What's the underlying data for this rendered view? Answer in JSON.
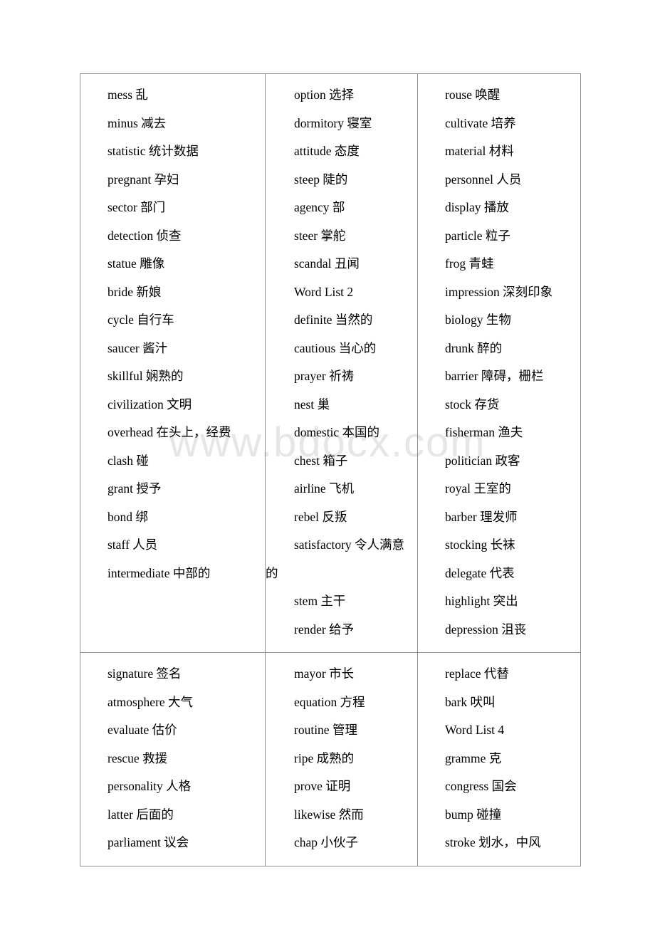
{
  "document": {
    "type": "vocabulary-table",
    "watermark": "www.bdocx.com",
    "page_background": "#ffffff",
    "border_color": "#8f8f8f",
    "text_color": "#000000",
    "watermark_color": "#e6e6e6"
  },
  "table": {
    "rows": [
      {
        "cells": [
          {
            "column": 1,
            "entries": [
              "mess 乱",
              "minus 减去",
              "statistic 统计数据",
              "pregnant 孕妇",
              "sector 部门",
              "detection 侦查",
              "statue 雕像",
              "bride 新娘",
              "cycle 自行车",
              "saucer 酱汁",
              "skillful 娴熟的",
              "civilization 文明",
              "overhead 在头上，经费",
              "clash 碰",
              "grant 授予",
              "bond 绑",
              "staff 人员",
              "intermediate 中部的"
            ]
          },
          {
            "column": 2,
            "entries": [
              "option 选择",
              "dormitory 寝室",
              "attitude 态度",
              "steep 陡的",
              "agency 部",
              "steer 掌舵",
              "scandal 丑闻",
              "Word List 2",
              "definite 当然的",
              "cautious 当心的",
              "prayer 祈祷",
              "nest 巢",
              "domestic 本国的",
              "chest 箱子",
              "airline 飞机",
              "rebel 反叛",
              "satisfactory 令人满意的",
              "stem 主干",
              "render 给予"
            ]
          },
          {
            "column": 3,
            "entries": [
              "rouse 唤醒",
              "cultivate 培养",
              "material 材料",
              "personnel 人员",
              "display 播放",
              "particle 粒子",
              "frog 青蛙",
              "impression 深刻印象",
              "biology 生物",
              "drunk 醉的",
              "barrier 障碍，栅栏",
              "stock 存货",
              "fisherman 渔夫",
              "politician 政客",
              "royal 王室的",
              "barber 理发师",
              "stocking 长袜",
              "delegate 代表",
              "highlight 突出",
              "depression 沮丧"
            ]
          }
        ]
      },
      {
        "cells": [
          {
            "column": 1,
            "entries": [
              "signature 签名",
              "atmosphere 大气",
              "evaluate 估价",
              "rescue 救援",
              "personality 人格",
              "latter 后面的",
              "parliament 议会"
            ]
          },
          {
            "column": 2,
            "entries": [
              "mayor 市长",
              "equation 方程",
              "routine 管理",
              "ripe 成熟的",
              "prove 证明",
              "likewise 然而",
              "chap 小伙子"
            ]
          },
          {
            "column": 3,
            "entries": [
              "replace 代替",
              "bark 吠叫",
              "Word List 4",
              "gramme 克",
              "congress 国会",
              "bump 碰撞",
              "stroke 划水，中风"
            ]
          }
        ]
      }
    ]
  }
}
